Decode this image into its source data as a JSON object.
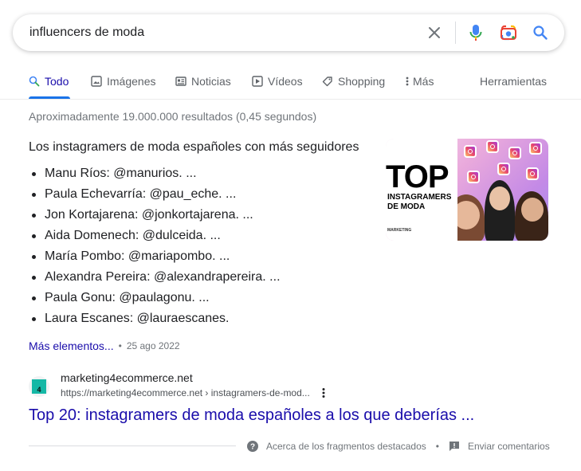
{
  "search": {
    "query": "influencers de moda",
    "icons": [
      "close-icon",
      "mic-icon",
      "lens-icon",
      "search-icon"
    ]
  },
  "tabs": [
    {
      "label": "Todo",
      "icon": "search-icon",
      "active": true
    },
    {
      "label": "Imágenes",
      "icon": "image-icon"
    },
    {
      "label": "Noticias",
      "icon": "news-icon"
    },
    {
      "label": "Vídeos",
      "icon": "play-icon"
    },
    {
      "label": "Shopping",
      "icon": "tag-icon"
    },
    {
      "label": "Más",
      "icon": "more-vert-icon"
    }
  ],
  "tools_label": "Herramientas",
  "stats": "Aproximadamente 19.000.000 resultados (0,45 segundos)",
  "snippet": {
    "heading": "Los instagramers de moda españoles con más seguidores",
    "items": [
      "Manu Ríos: @manurios. ...",
      "Paula Echevarría: @pau_eche. ...",
      "Jon Kortajarena: @jonkortajarena. ...",
      "Aida Domenech: @dulceida. ...",
      "María Pombo: @mariapombo. ...",
      "Alexandra Pereira: @alexandrapereira. ...",
      "Paula Gonu: @paulagonu. ...",
      "Laura Escanes: @lauraescanes."
    ],
    "image": {
      "top": "TOP",
      "line1": "INSTAGRAMERS",
      "line2": "DE MODA",
      "brand": "MARKETING"
    },
    "more_label": "Más elementos...",
    "date": "25 ago 2022"
  },
  "result": {
    "favicon_text": "4",
    "site": "marketing4ecommerce.net",
    "url": "https://marketing4ecommerce.net › instagramers-de-mod...",
    "title": "Top 20: instagramers de moda españoles a los que deberías ..."
  },
  "footer": {
    "about": "Acerca de los fragmentos destacados",
    "feedback": "Enviar comentarios"
  },
  "colors": {
    "link": "#1a0dab",
    "accent": "#1a73e8",
    "muted": "#70757a"
  }
}
